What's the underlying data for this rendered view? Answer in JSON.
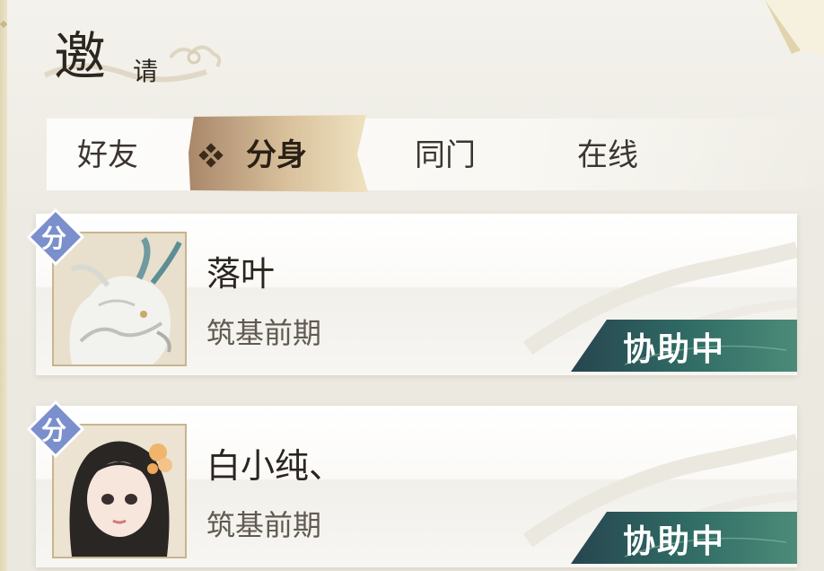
{
  "header": {
    "title_main": "邀",
    "title_sub": "请"
  },
  "tabs": [
    {
      "label": "好友",
      "active": false
    },
    {
      "label": "分身",
      "active": true
    },
    {
      "label": "同门",
      "active": false
    },
    {
      "label": "在线",
      "active": false
    }
  ],
  "players": [
    {
      "badge": "分",
      "name": "落叶",
      "realm": "筑基前期",
      "status": "协助中",
      "avatar_icon": "white-dragon-icon"
    },
    {
      "badge": "分",
      "name": "白小纯、",
      "realm": "筑基前期",
      "status": "协助中",
      "avatar_icon": "girl-portrait-icon"
    }
  ],
  "colors": {
    "active_tab": "#c9a57a",
    "status_badge": "#2f6f6a",
    "clone_badge": "#7287c4"
  }
}
